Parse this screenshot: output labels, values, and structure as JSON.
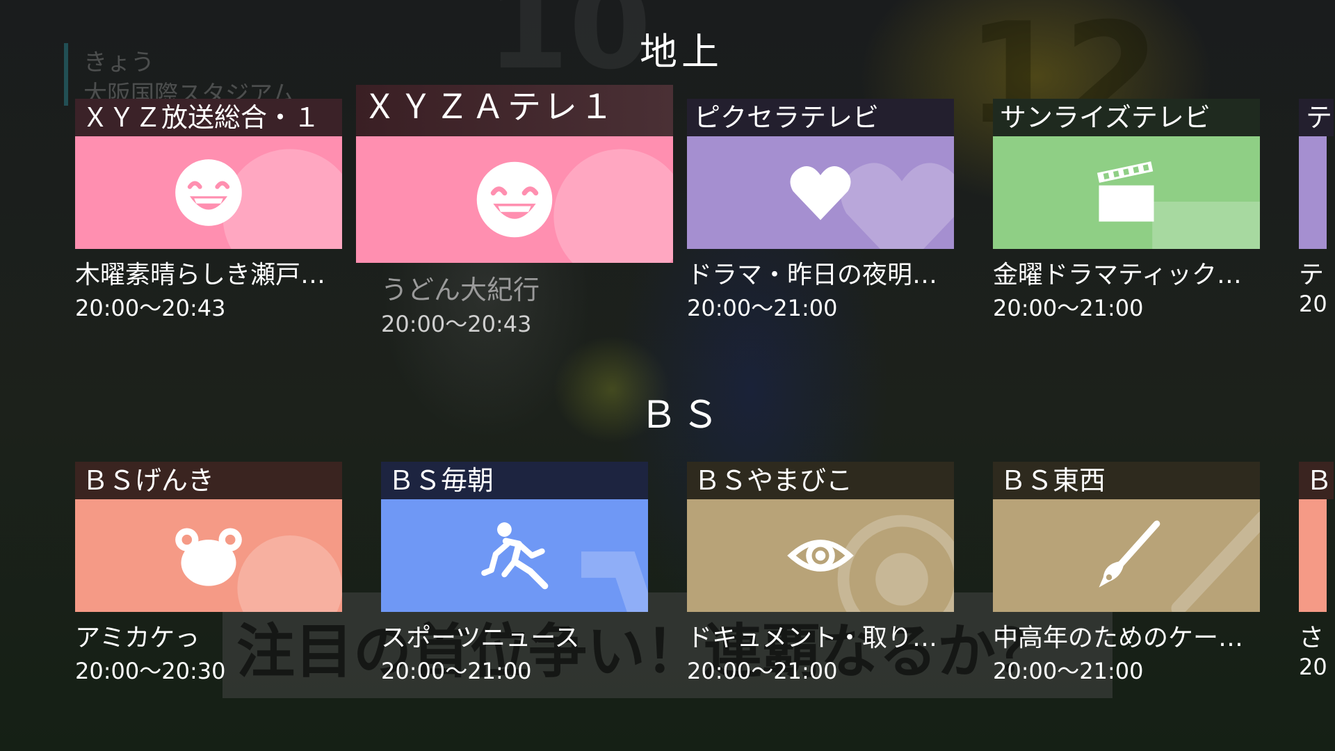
{
  "background": {
    "today_label": "きょう",
    "venue": "大阪国際スタジアム",
    "headline": "注目の首位争い！連覇なるか？"
  },
  "sections": [
    {
      "title": "地上",
      "channels": [
        {
          "name": "ＸＹＺ放送総合・１",
          "program": "木曜素晴らしき瀬戸…",
          "time": "20:00〜20:43",
          "icon": "smiley-icon",
          "color": "#ff8fb0",
          "header_bg": "#3b2228"
        },
        {
          "name": "ＸＹＺＡテレ１",
          "program": "うどん大紀行",
          "time": "20:00〜20:43",
          "icon": "smiley-icon",
          "color": "#ff8fb0",
          "header_bg": "#3b2228"
        },
        {
          "name": "ピクセラテレビ",
          "program": "ドラマ・昨日の夜明…",
          "time": "20:00〜21:00",
          "icon": "heart-icon",
          "color": "#a58fd0",
          "header_bg": "#231f2e"
        },
        {
          "name": "サンライズテレビ",
          "program": "金曜ドラマティック…",
          "time": "20:00〜21:00",
          "icon": "clapperboard-icon",
          "color": "#8fcf85",
          "header_bg": "#1f2a1f"
        },
        {
          "name": "テ",
          "program": "テ",
          "time": "20",
          "icon": "",
          "color": "#a58fd0",
          "header_bg": "#231f2e"
        }
      ]
    },
    {
      "title": "ＢＳ",
      "channels": [
        {
          "name": "ＢＳげんき",
          "program": "アミカケっ",
          "time": "20:00〜20:30",
          "icon": "bear-icon",
          "color": "#f59a86",
          "header_bg": "#3a2420"
        },
        {
          "name": "ＢＳ毎朝",
          "program": "スポーツニュース",
          "time": "20:00〜21:00",
          "icon": "runner-icon",
          "color": "#6f98f5",
          "header_bg": "#1d2440"
        },
        {
          "name": "ＢＳやまびこ",
          "program": "ドキュメント・取り…",
          "time": "20:00〜21:00",
          "icon": "eye-icon",
          "color": "#b8a378",
          "header_bg": "#2e2a1e"
        },
        {
          "name": "ＢＳ東西",
          "program": "中高年のためのケー…",
          "time": "20:00〜21:00",
          "icon": "brush-icon",
          "color": "#b8a378",
          "header_bg": "#2e2a1e"
        },
        {
          "name": "Ｂ",
          "program": "さ",
          "time": "20",
          "icon": "",
          "color": "#f59a86",
          "header_bg": "#3a2420"
        }
      ]
    }
  ]
}
